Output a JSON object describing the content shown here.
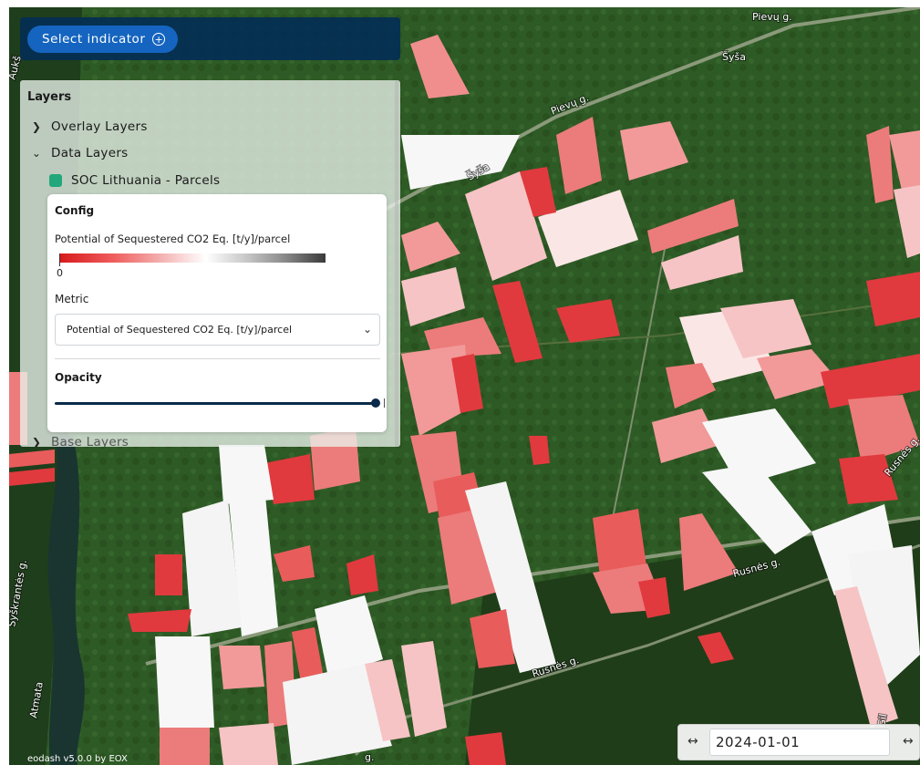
{
  "top_bar": {
    "select_indicator_label": "Select indicator",
    "select_indicator_icon": "plus-circle-icon"
  },
  "layers_panel": {
    "title": "Layers",
    "groups": [
      {
        "label": "Overlay Layers",
        "expanded": false
      },
      {
        "label": "Data Layers",
        "expanded": true
      },
      {
        "label": "Base Layers",
        "expanded": false
      }
    ],
    "active_layer": {
      "label": "SOC Lithuania - Parcels",
      "color": "#21a779"
    },
    "config": {
      "title": "Config",
      "legend_label": "Potential of Sequestered CO2 Eq. [t/y]/parcel",
      "legend_min": "0",
      "legend_colors": [
        "#d7191c",
        "#ffffff",
        "#3a3a3a"
      ],
      "metric_label": "Metric",
      "metric_value": "Potential of Sequestered CO2 Eq. [t/y]/parcel",
      "opacity_label": "Opacity",
      "opacity_value": 1.0
    }
  },
  "map": {
    "street_labels": [
      "Pievų g.",
      "Pievų g.",
      "Šyša",
      "Šyša",
      "Rusnės g.",
      "Rusnės g.",
      "Rusnės g.",
      "Šyškrantės g.",
      "Atmata",
      "Aukš",
      "Gil",
      "g."
    ],
    "parcel_colors": {
      "high": "#e0393e",
      "mid": "#ec7b7b",
      "low": "#f6c4c4",
      "none": "#f4f4f4"
    }
  },
  "date_selector": {
    "value": "2024-01-01",
    "prev_icon": "arrow-left-right-icon",
    "next_icon": "arrow-left-right-icon"
  },
  "attribution": "eodash v5.0.0 by EOX"
}
